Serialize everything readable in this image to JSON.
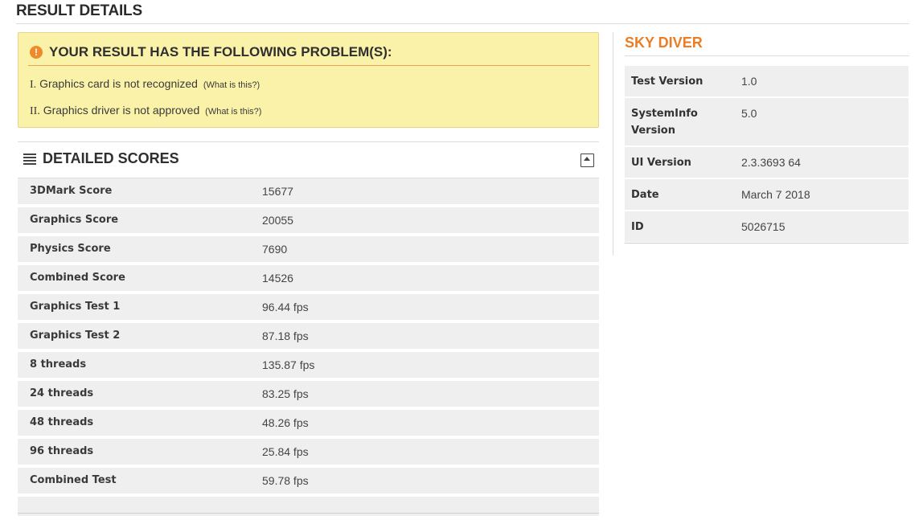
{
  "page": {
    "title": "RESULT DETAILS"
  },
  "warning": {
    "title": "YOUR RESULT HAS THE FOLLOWING PROBLEM(S):",
    "problems": [
      {
        "num": "I.",
        "text": "Graphics card is not recognized",
        "help": "(What is this?)"
      },
      {
        "num": "II.",
        "text": "Graphics driver is not approved",
        "help": "(What is this?)"
      }
    ]
  },
  "scores": {
    "title": "DETAILED SCORES",
    "rows": [
      {
        "label": "3DMark Score",
        "value": "15677"
      },
      {
        "label": "Graphics Score",
        "value": "20055"
      },
      {
        "label": "Physics Score",
        "value": "7690"
      },
      {
        "label": "Combined Score",
        "value": "14526"
      },
      {
        "label": "Graphics Test 1",
        "value": "96.44 fps"
      },
      {
        "label": "Graphics Test 2",
        "value": "87.18 fps"
      },
      {
        "label": "8 threads",
        "value": "135.87 fps"
      },
      {
        "label": "24 threads",
        "value": "83.25 fps"
      },
      {
        "label": "48 threads",
        "value": "48.26 fps"
      },
      {
        "label": "96 threads",
        "value": "25.84 fps"
      },
      {
        "label": "Combined Test",
        "value": "59.78 fps"
      },
      {
        "label": "",
        "value": ""
      }
    ]
  },
  "sky_diver": {
    "title": "SKY DIVER",
    "rows": [
      {
        "key": "Test Version",
        "value": "1.0"
      },
      {
        "key": "SystemInfo Version",
        "value": "5.0"
      },
      {
        "key": "UI Version",
        "value": "2.3.3693 64"
      },
      {
        "key": "Date",
        "value": "March 7 2018"
      },
      {
        "key": "ID",
        "value": "5026715"
      }
    ]
  },
  "colors": {
    "accent": "#ea7d25",
    "warning_bg": "#fbf2a9",
    "row_bg": "#efefef"
  },
  "icons": {
    "warning": "exclamation-circle-icon",
    "scores": "menu-lines-icon",
    "collapse": "collapse-up-icon"
  }
}
